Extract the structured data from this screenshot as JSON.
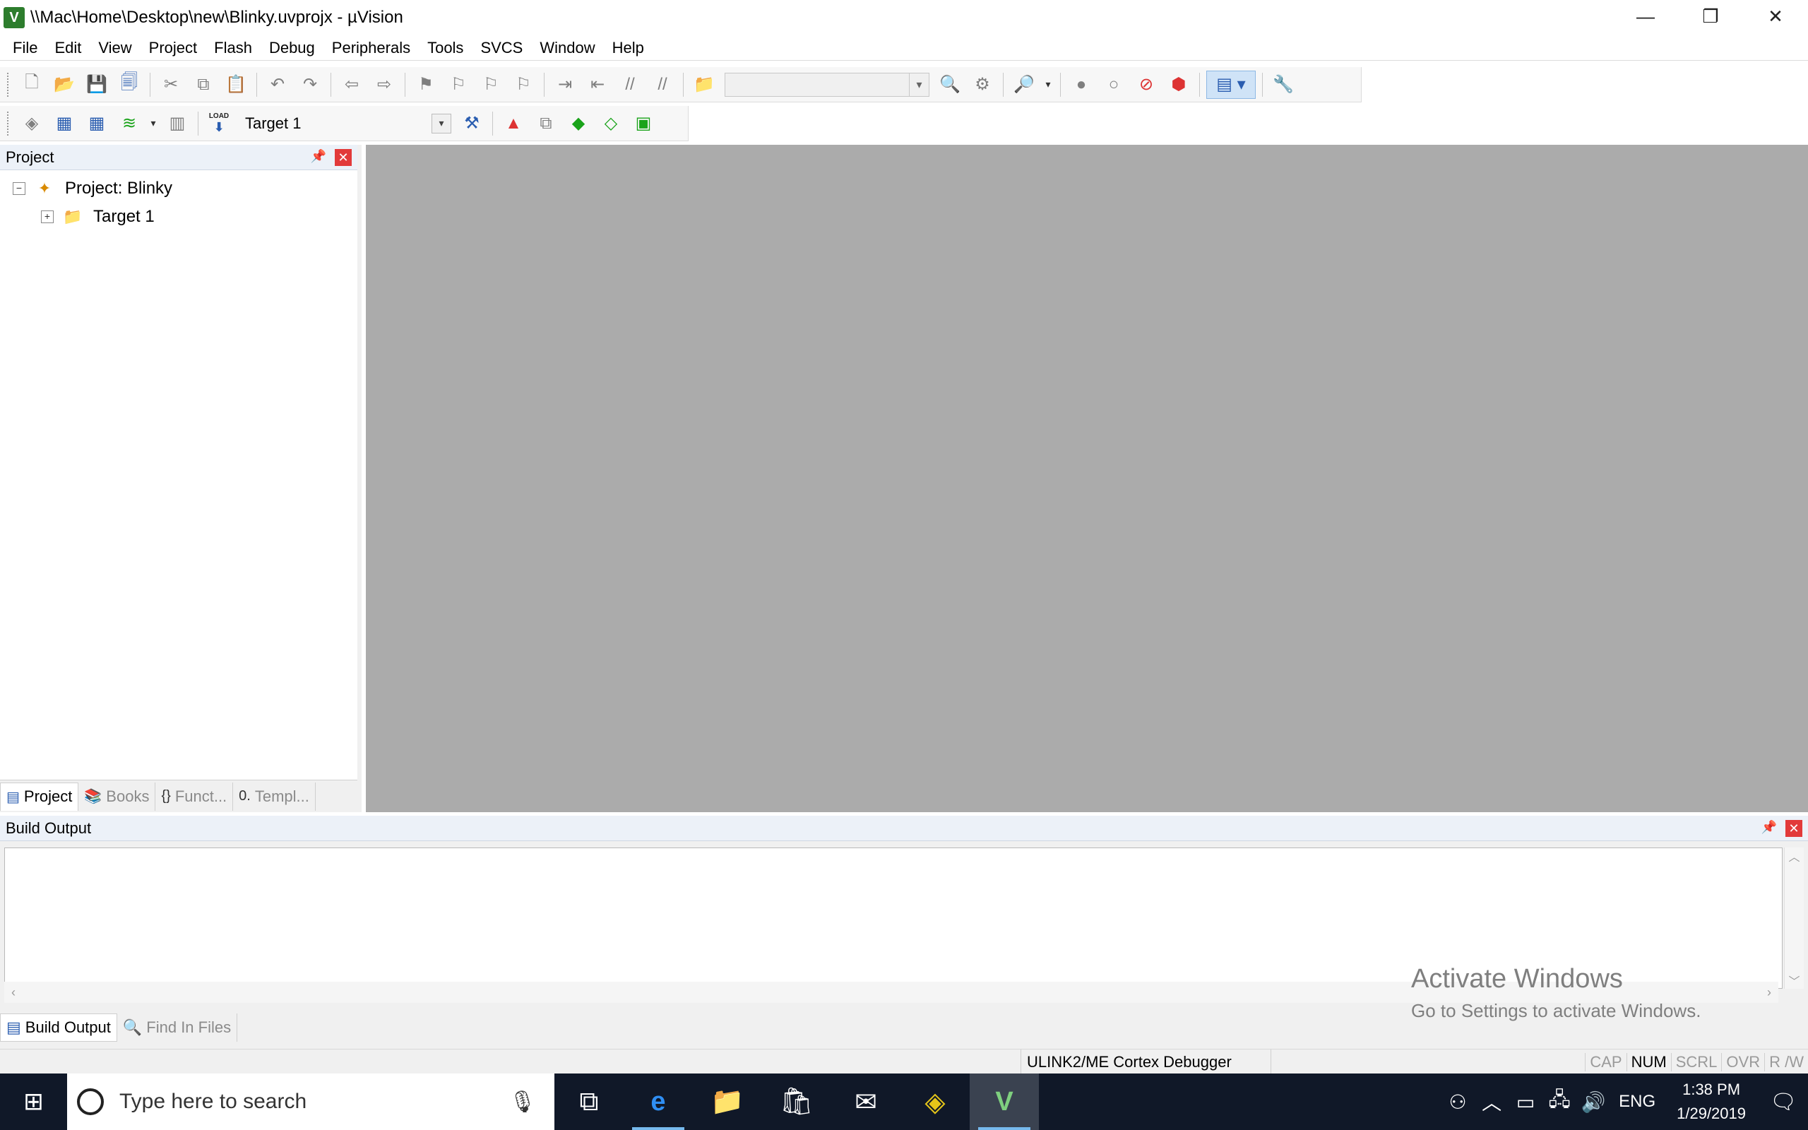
{
  "window": {
    "title": "\\\\Mac\\Home\\Desktop\\new\\Blinky.uvprojx - µVision",
    "app_icon": "V",
    "controls": {
      "minimize": "—",
      "restore": "❐",
      "close": "✕"
    }
  },
  "menu": [
    "File",
    "Edit",
    "View",
    "Project",
    "Flash",
    "Debug",
    "Peripherals",
    "Tools",
    "SVCS",
    "Window",
    "Help"
  ],
  "toolbar2": {
    "load_label": "LOAD",
    "target_select": "Target 1"
  },
  "project_panel": {
    "title": "Project",
    "tree": {
      "root": "Project: Blinky",
      "child": "Target 1"
    },
    "tabs": [
      "Project",
      "Books",
      "Funct...",
      "Templ..."
    ]
  },
  "build_panel": {
    "title": "Build Output",
    "tabs": [
      "Build Output",
      "Find In Files"
    ]
  },
  "watermark": {
    "title": "Activate Windows",
    "subtitle": "Go to Settings to activate Windows."
  },
  "statusbar": {
    "debugger": "ULINK2/ME Cortex Debugger",
    "flags": [
      "CAP",
      "NUM",
      "SCRL",
      "OVR",
      "R /W"
    ]
  },
  "taskbar": {
    "search_placeholder": "Type here to search",
    "language": "ENG",
    "time": "1:38 PM",
    "date": "1/29/2019"
  },
  "colors": {
    "editor_bg": "#ababab",
    "taskbar_bg": "#101828",
    "panel_header_bg": "#ecf1f8"
  }
}
